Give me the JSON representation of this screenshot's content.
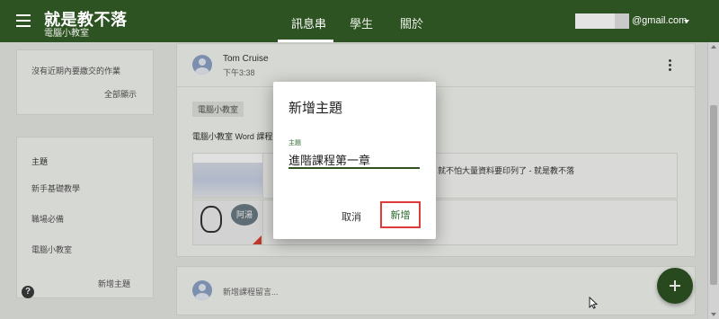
{
  "header": {
    "class_title": "就是教不落",
    "class_subtitle": "電腦小教室",
    "tabs": [
      {
        "label": "訊息串",
        "active": true
      },
      {
        "label": "學生",
        "active": false
      },
      {
        "label": "關於",
        "active": false
      }
    ],
    "account_email": "@gmail.com",
    "menu_icon": "hamburger-menu-icon",
    "bar_color": "#2e5323"
  },
  "sidebar": {
    "upcoming": {
      "text": "沒有近期內要繳交的作業",
      "view_all": "全部顯示"
    },
    "topics": {
      "heading": "主題",
      "items": [
        "新手基礎教學",
        "職場必備",
        "電腦小教室"
      ],
      "add_link": "新增主題"
    },
    "help_icon": "?"
  },
  "post": {
    "author": "Tom Cruise",
    "time": "下午3:38",
    "topic_chip": "電腦小教室",
    "body": "電腦小教室 Word 課程",
    "attachment_title": "就不怕大量資料要印列了 - 就是教不落",
    "bubble_text": "阿湯"
  },
  "comment": {
    "placeholder": "新增課程留言..."
  },
  "fab": {
    "icon": "plus-icon",
    "color": "#2e5323"
  },
  "dialog": {
    "title": "新增主題",
    "field_label": "主題",
    "field_value": "進階課程第一章",
    "cancel_label": "取消",
    "add_label": "新增",
    "highlight_color": "#e03b3b"
  }
}
